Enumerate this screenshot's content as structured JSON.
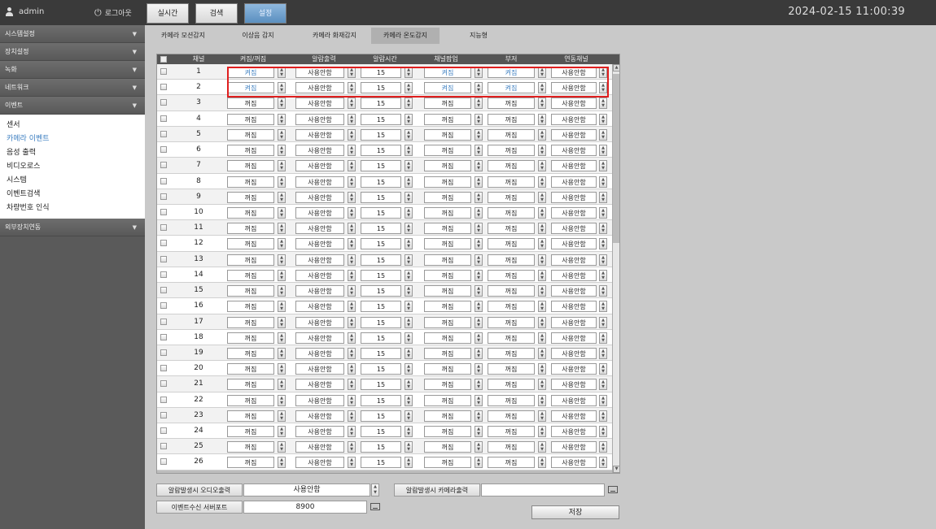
{
  "header": {
    "user": "admin",
    "logout": "로그아웃",
    "tabs": [
      "실시간",
      "검색",
      "설정"
    ],
    "active_tab": "설정",
    "datetime": "2024-02-15 11:00:39"
  },
  "sidebar": {
    "items": [
      "시스템설정",
      "장치설정",
      "녹화",
      "네트워크",
      "이벤트"
    ],
    "sub_items": [
      "센서",
      "카메라 이벤트",
      "음성 출력",
      "비디오로스",
      "시스템",
      "이벤트검색",
      "차량번호 인식"
    ],
    "active_sub": "카메라 이벤트",
    "bottom_item": "외부장치연동"
  },
  "subtabs": [
    "카메라 모션감지",
    "이상음 감지",
    "카메라 화재감지",
    "카메라 온도감지",
    "지능형"
  ],
  "active_subtab": "카메라 온도감지",
  "table": {
    "headers": [
      "채널",
      "켜짐/꺼짐",
      "알람출력",
      "알람시간",
      "채널팝업",
      "부저",
      "연동채널"
    ],
    "rows": [
      {
        "ch": "1",
        "onoff": "켜짐",
        "alarm_out": "사용안함",
        "alarm_time": "15",
        "popup": "켜짐",
        "buzzer": "켜짐",
        "link": "사용안함"
      },
      {
        "ch": "2",
        "onoff": "켜짐",
        "alarm_out": "사용안함",
        "alarm_time": "15",
        "popup": "켜짐",
        "buzzer": "켜짐",
        "link": "사용안함"
      },
      {
        "ch": "3",
        "onoff": "꺼짐",
        "alarm_out": "사용안함",
        "alarm_time": "15",
        "popup": "꺼짐",
        "buzzer": "꺼짐",
        "link": "사용안함"
      },
      {
        "ch": "4",
        "onoff": "꺼짐",
        "alarm_out": "사용안함",
        "alarm_time": "15",
        "popup": "꺼짐",
        "buzzer": "꺼짐",
        "link": "사용안함"
      },
      {
        "ch": "5",
        "onoff": "꺼짐",
        "alarm_out": "사용안함",
        "alarm_time": "15",
        "popup": "꺼짐",
        "buzzer": "꺼짐",
        "link": "사용안함"
      },
      {
        "ch": "6",
        "onoff": "꺼짐",
        "alarm_out": "사용안함",
        "alarm_time": "15",
        "popup": "꺼짐",
        "buzzer": "꺼짐",
        "link": "사용안함"
      },
      {
        "ch": "7",
        "onoff": "꺼짐",
        "alarm_out": "사용안함",
        "alarm_time": "15",
        "popup": "꺼짐",
        "buzzer": "꺼짐",
        "link": "사용안함"
      },
      {
        "ch": "8",
        "onoff": "꺼짐",
        "alarm_out": "사용안함",
        "alarm_time": "15",
        "popup": "꺼짐",
        "buzzer": "꺼짐",
        "link": "사용안함"
      },
      {
        "ch": "9",
        "onoff": "꺼짐",
        "alarm_out": "사용안함",
        "alarm_time": "15",
        "popup": "꺼짐",
        "buzzer": "꺼짐",
        "link": "사용안함"
      },
      {
        "ch": "10",
        "onoff": "꺼짐",
        "alarm_out": "사용안함",
        "alarm_time": "15",
        "popup": "꺼짐",
        "buzzer": "꺼짐",
        "link": "사용안함"
      },
      {
        "ch": "11",
        "onoff": "꺼짐",
        "alarm_out": "사용안함",
        "alarm_time": "15",
        "popup": "꺼짐",
        "buzzer": "꺼짐",
        "link": "사용안함"
      },
      {
        "ch": "12",
        "onoff": "꺼짐",
        "alarm_out": "사용안함",
        "alarm_time": "15",
        "popup": "꺼짐",
        "buzzer": "꺼짐",
        "link": "사용안함"
      },
      {
        "ch": "13",
        "onoff": "꺼짐",
        "alarm_out": "사용안함",
        "alarm_time": "15",
        "popup": "꺼짐",
        "buzzer": "꺼짐",
        "link": "사용안함"
      },
      {
        "ch": "14",
        "onoff": "꺼짐",
        "alarm_out": "사용안함",
        "alarm_time": "15",
        "popup": "꺼짐",
        "buzzer": "꺼짐",
        "link": "사용안함"
      },
      {
        "ch": "15",
        "onoff": "꺼짐",
        "alarm_out": "사용안함",
        "alarm_time": "15",
        "popup": "꺼짐",
        "buzzer": "꺼짐",
        "link": "사용안함"
      },
      {
        "ch": "16",
        "onoff": "꺼짐",
        "alarm_out": "사용안함",
        "alarm_time": "15",
        "popup": "꺼짐",
        "buzzer": "꺼짐",
        "link": "사용안함"
      },
      {
        "ch": "17",
        "onoff": "꺼짐",
        "alarm_out": "사용안함",
        "alarm_time": "15",
        "popup": "꺼짐",
        "buzzer": "꺼짐",
        "link": "사용안함"
      },
      {
        "ch": "18",
        "onoff": "꺼짐",
        "alarm_out": "사용안함",
        "alarm_time": "15",
        "popup": "꺼짐",
        "buzzer": "꺼짐",
        "link": "사용안함"
      },
      {
        "ch": "19",
        "onoff": "꺼짐",
        "alarm_out": "사용안함",
        "alarm_time": "15",
        "popup": "꺼짐",
        "buzzer": "꺼짐",
        "link": "사용안함"
      },
      {
        "ch": "20",
        "onoff": "꺼짐",
        "alarm_out": "사용안함",
        "alarm_time": "15",
        "popup": "꺼짐",
        "buzzer": "꺼짐",
        "link": "사용안함"
      },
      {
        "ch": "21",
        "onoff": "꺼짐",
        "alarm_out": "사용안함",
        "alarm_time": "15",
        "popup": "꺼짐",
        "buzzer": "꺼짐",
        "link": "사용안함"
      },
      {
        "ch": "22",
        "onoff": "꺼짐",
        "alarm_out": "사용안함",
        "alarm_time": "15",
        "popup": "꺼짐",
        "buzzer": "꺼짐",
        "link": "사용안함"
      },
      {
        "ch": "23",
        "onoff": "꺼짐",
        "alarm_out": "사용안함",
        "alarm_time": "15",
        "popup": "꺼짐",
        "buzzer": "꺼짐",
        "link": "사용안함"
      },
      {
        "ch": "24",
        "onoff": "꺼짐",
        "alarm_out": "사용안함",
        "alarm_time": "15",
        "popup": "꺼짐",
        "buzzer": "꺼짐",
        "link": "사용안함"
      },
      {
        "ch": "25",
        "onoff": "꺼짐",
        "alarm_out": "사용안함",
        "alarm_time": "15",
        "popup": "꺼짐",
        "buzzer": "꺼짐",
        "link": "사용안함"
      },
      {
        "ch": "26",
        "onoff": "꺼짐",
        "alarm_out": "사용안함",
        "alarm_time": "15",
        "popup": "꺼짐",
        "buzzer": "꺼짐",
        "link": "사용안함"
      }
    ]
  },
  "bottom": {
    "audio_label": "알람발생시 오디오출력",
    "audio_value": "사용안함",
    "camera_out_label": "알람발생시 카메라출력",
    "camera_out_value": "",
    "port_label": "이벤트수신 서버포트",
    "port_value": "8900",
    "save_label": "저장"
  },
  "colors": {
    "highlight": "#e01e1e",
    "active_text": "#3a7dc0",
    "active_tab": "#5a8fbf"
  }
}
